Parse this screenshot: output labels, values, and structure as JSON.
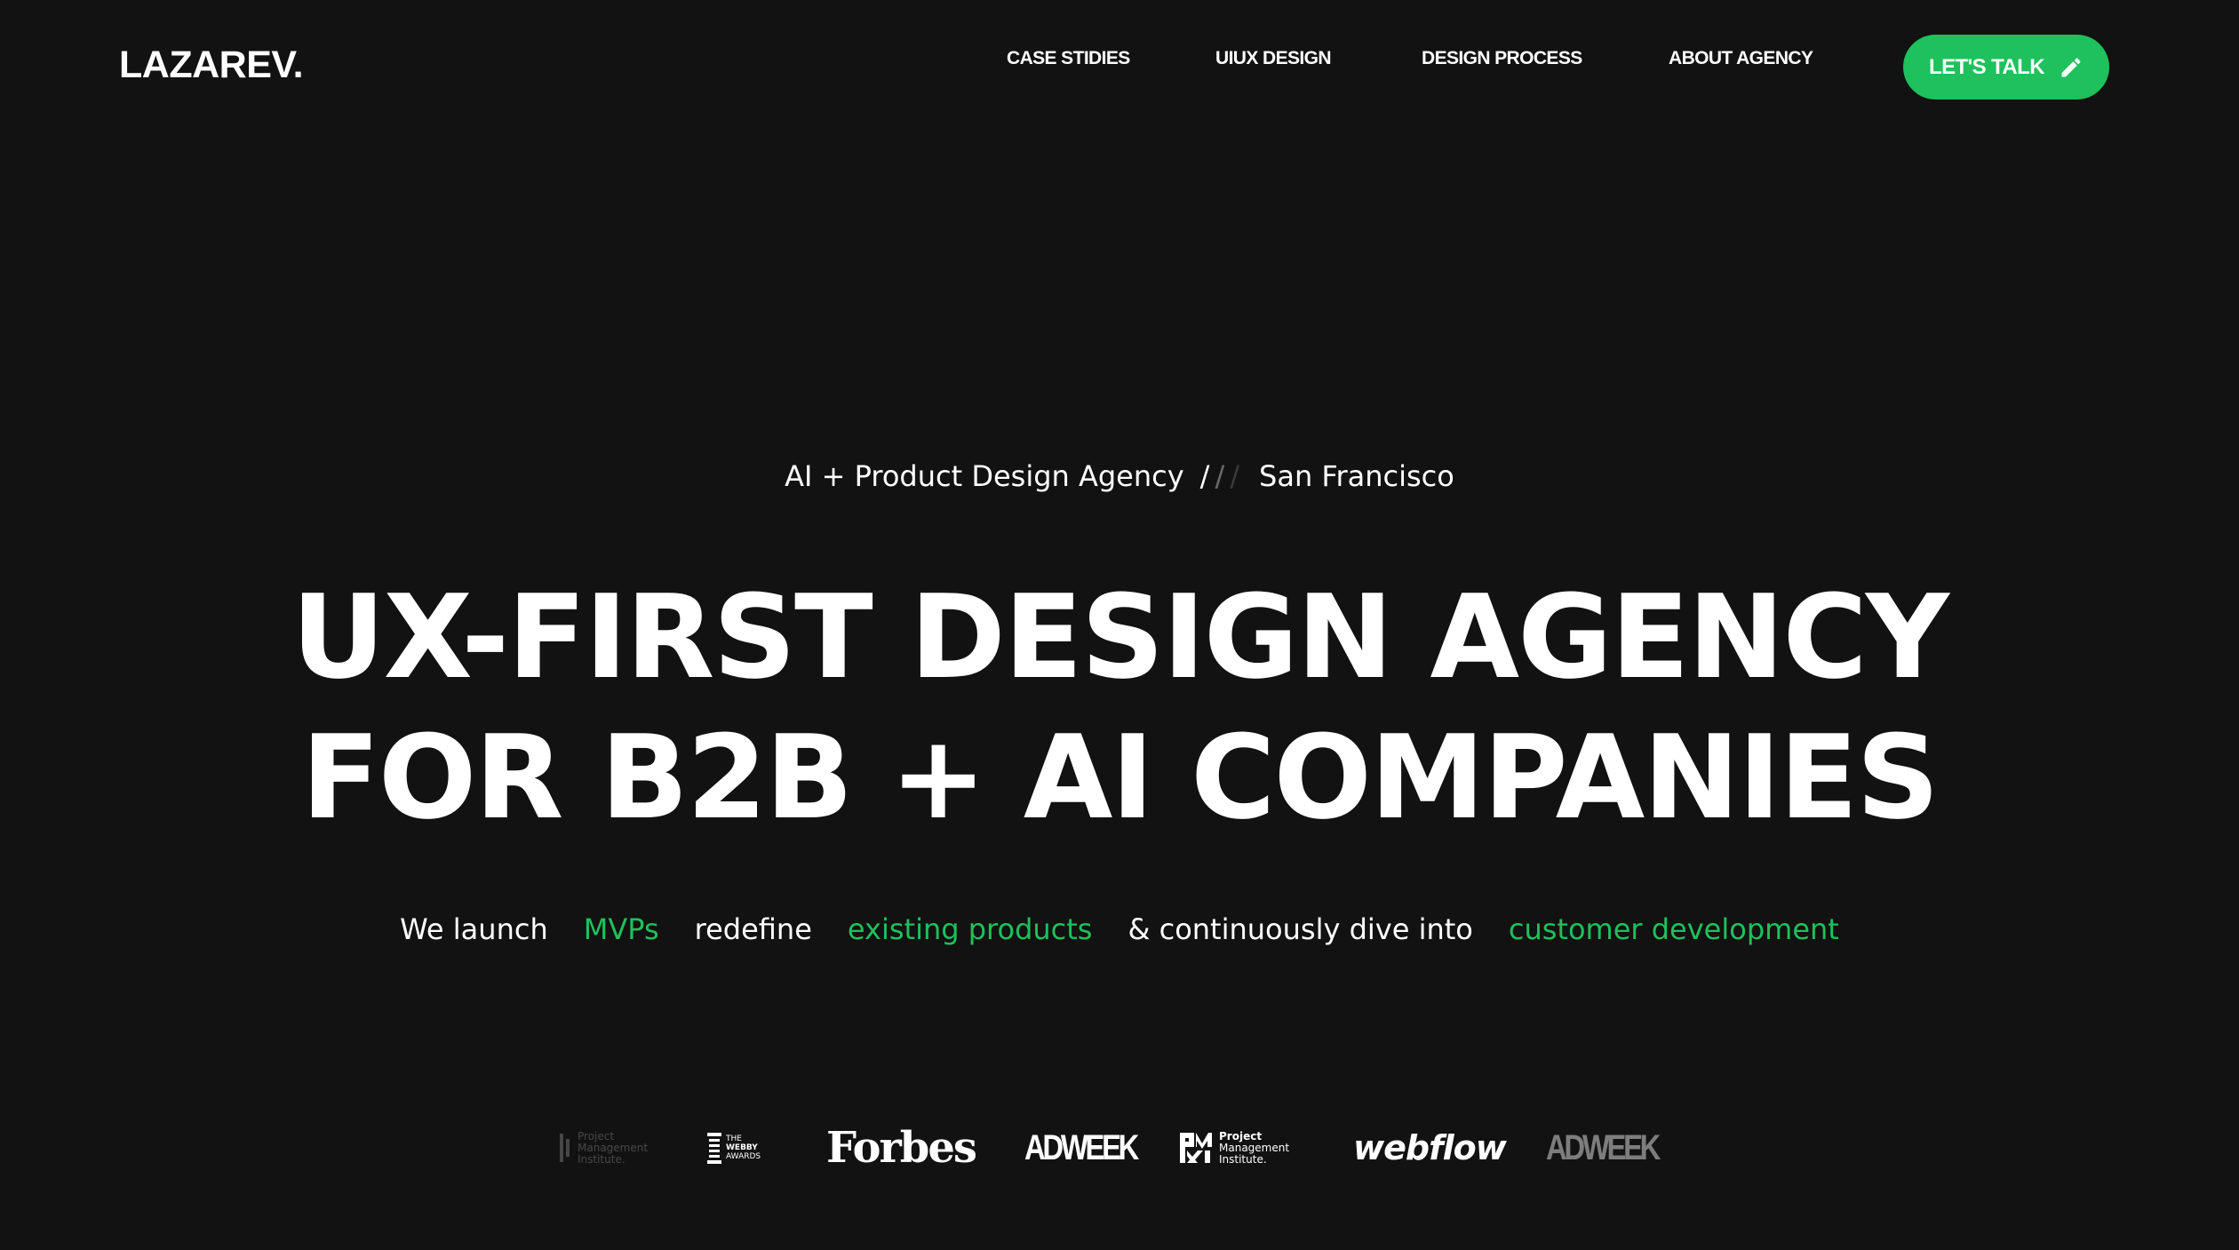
{
  "header": {
    "logo": "LAZAREV.",
    "nav": [
      {
        "label": "CASE STIDIES"
      },
      {
        "label": "UIUX DESIGN"
      },
      {
        "label": "DESIGN PROCESS"
      },
      {
        "label": "ABOUT AGENCY"
      }
    ],
    "cta": {
      "label": "LET'S TALK",
      "icon": "pencil-icon"
    }
  },
  "hero": {
    "eyebrow": {
      "left": "AI + Product Design Agency",
      "slashes": [
        "/",
        "/",
        "/"
      ],
      "right": "San Francisco"
    },
    "headline": {
      "line1": "UX-FIRST DESIGN AGENCY",
      "line2": "FOR B2B + AI COMPANIES"
    },
    "tagline": [
      {
        "text": "We launch",
        "accent": false
      },
      {
        "text": "MVPs",
        "accent": true
      },
      {
        "text": "redefine",
        "accent": false
      },
      {
        "text": "existing products",
        "accent": true
      },
      {
        "text": "& continuously dive into",
        "accent": false
      },
      {
        "text": "customer development",
        "accent": true
      }
    ]
  },
  "press": {
    "pmi_faded": {
      "line1": "Project",
      "line2": "Management",
      "line3": "Institute."
    },
    "webby": {
      "line1": "THE",
      "line2": "WEBBY",
      "line3": "AWARDS"
    },
    "forbes": "Forbes",
    "adweek": "ADWEEK",
    "pmi": {
      "mark": "PMI",
      "line1": "Project",
      "line2": "Management",
      "line3": "Institute."
    },
    "webflow": "webflow",
    "adweek_faded": "ADWEEK"
  },
  "colors": {
    "background": "#121212",
    "accent": "#1ec15b",
    "text": "#ffffff"
  }
}
